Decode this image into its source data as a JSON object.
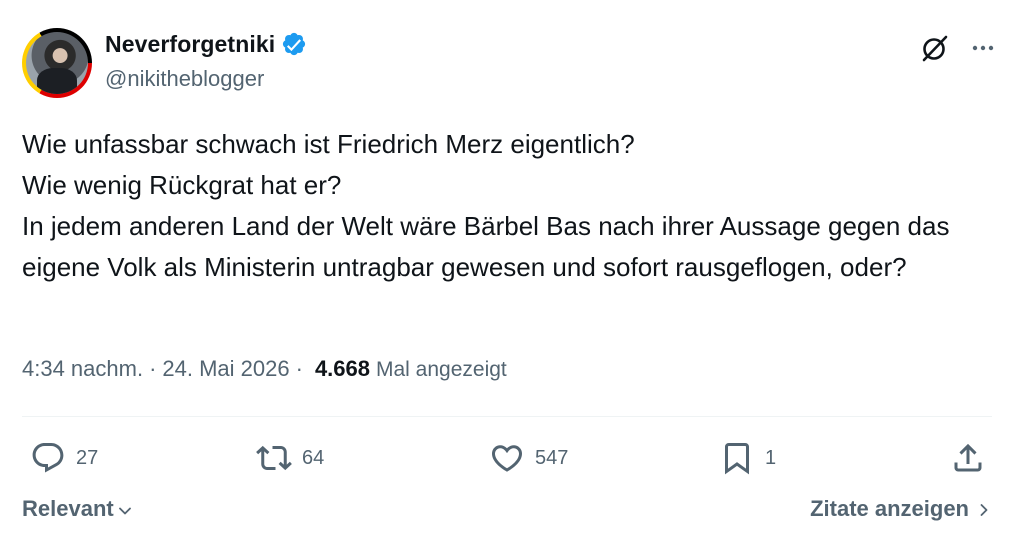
{
  "user": {
    "display_name": "Neverforgetniki",
    "handle": "@nikitheblogger",
    "verified": true
  },
  "icons": {
    "grok": "grok-icon",
    "more": "more-icon",
    "reply": "reply-icon",
    "retweet": "retweet-icon",
    "like": "like-icon",
    "bookmark": "bookmark-icon",
    "share": "share-icon",
    "verified": "verified-badge-icon"
  },
  "tweet": {
    "text": "Wie unfassbar schwach ist Friedrich Merz eigentlich?\nWie wenig Rückgrat hat er?\nIn jedem anderen Land der Welt wäre Bärbel Bas nach ihrer Aussage gegen das eigene Volk als Ministerin untragbar gewesen und sofort rausgeflogen, oder?",
    "time": "4:34 nachm.",
    "date": "24. Mai 2026",
    "separator": "·",
    "views_count": "4.668",
    "views_label": "Mal angezeigt"
  },
  "actions": {
    "replies": "27",
    "retweets": "64",
    "likes": "547",
    "bookmarks": "1"
  },
  "footer": {
    "sort_label": "Relevant",
    "quotes_label": "Zitate anzeigen"
  },
  "colors": {
    "text": "#0f1419",
    "secondary": "#536471",
    "verified": "#1d9bf0",
    "divider": "#eff3f4"
  }
}
